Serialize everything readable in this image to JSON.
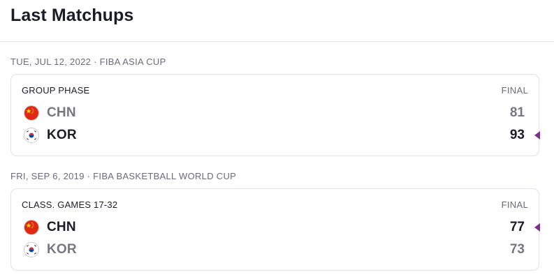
{
  "title": "Last Matchups",
  "matchups": [
    {
      "date_label": "TUE, JUL 12, 2022 · FIBA ASIA CUP",
      "phase": "GROUP PHASE",
      "status": "FINAL",
      "teams": [
        {
          "abbr": "CHN",
          "score": "81",
          "flag_icon": "china-flag-icon",
          "winner": false
        },
        {
          "abbr": "KOR",
          "score": "93",
          "flag_icon": "korea-flag-icon",
          "winner": true
        }
      ]
    },
    {
      "date_label": "FRI, SEP 6, 2019 · FIBA BASKETBALL WORLD CUP",
      "phase": "CLASS. GAMES 17-32",
      "status": "FINAL",
      "teams": [
        {
          "abbr": "CHN",
          "score": "77",
          "flag_icon": "china-flag-icon",
          "winner": true
        },
        {
          "abbr": "KOR",
          "score": "73",
          "flag_icon": "korea-flag-icon",
          "winner": false
        }
      ]
    }
  ],
  "colors": {
    "winner_marker": "#7b2f8c",
    "winner_text": "#1c1c28",
    "loser_text": "#777782"
  }
}
